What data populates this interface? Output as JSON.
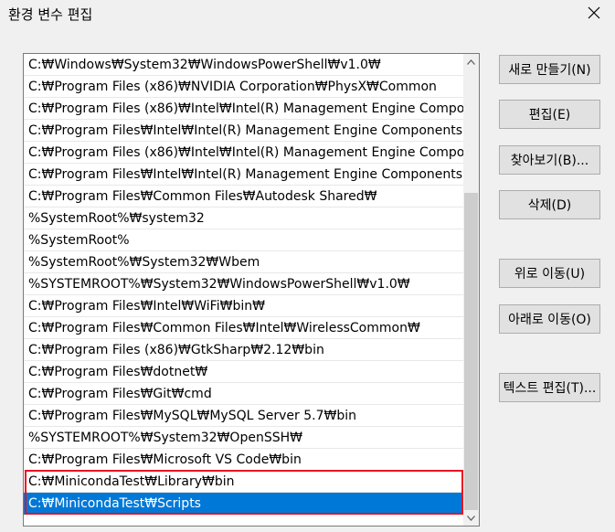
{
  "window": {
    "title": "환경 변수 편집"
  },
  "path_list": {
    "items": [
      "C:₩Windows₩System32₩WindowsPowerShell₩v1.0₩",
      "C:₩Program Files (x86)₩NVIDIA Corporation₩PhysX₩Common",
      "C:₩Program Files (x86)₩Intel₩Intel(R) Management Engine Compo...",
      "C:₩Program Files₩Intel₩Intel(R) Management Engine Components...",
      "C:₩Program Files (x86)₩Intel₩Intel(R) Management Engine Compo...",
      "C:₩Program Files₩Intel₩Intel(R) Management Engine Components...",
      "C:₩Program Files₩Common Files₩Autodesk Shared₩",
      "%SystemRoot%₩system32",
      "%SystemRoot%",
      "%SystemRoot%₩System32₩Wbem",
      "%SYSTEMROOT%₩System32₩WindowsPowerShell₩v1.0₩",
      "C:₩Program Files₩Intel₩WiFi₩bin₩",
      "C:₩Program Files₩Common Files₩Intel₩WirelessCommon₩",
      "C:₩Program Files (x86)₩GtkSharp₩2.12₩bin",
      "C:₩Program Files₩dotnet₩",
      "C:₩Program Files₩Git₩cmd",
      "C:₩Program Files₩MySQL₩MySQL Server 5.7₩bin",
      "%SYSTEMROOT%₩System32₩OpenSSH₩",
      "C:₩Program Files₩Microsoft VS Code₩bin",
      "C:₩MinicondaTest₩Library₩bin",
      "C:₩MinicondaTest₩Scripts"
    ],
    "selected_index": 20,
    "scroll_position": 1.0
  },
  "buttons": {
    "new": "새로 만들기(N)",
    "edit": "편집(E)",
    "browse": "찾아보기(B)...",
    "delete": "삭제(D)",
    "move_up": "위로 이동(U)",
    "move_down": "아래로 이동(O)",
    "edit_text": "텍스트 편집(T)..."
  },
  "colors": {
    "selection": "#0078d7",
    "highlight_border": "#e81123"
  }
}
